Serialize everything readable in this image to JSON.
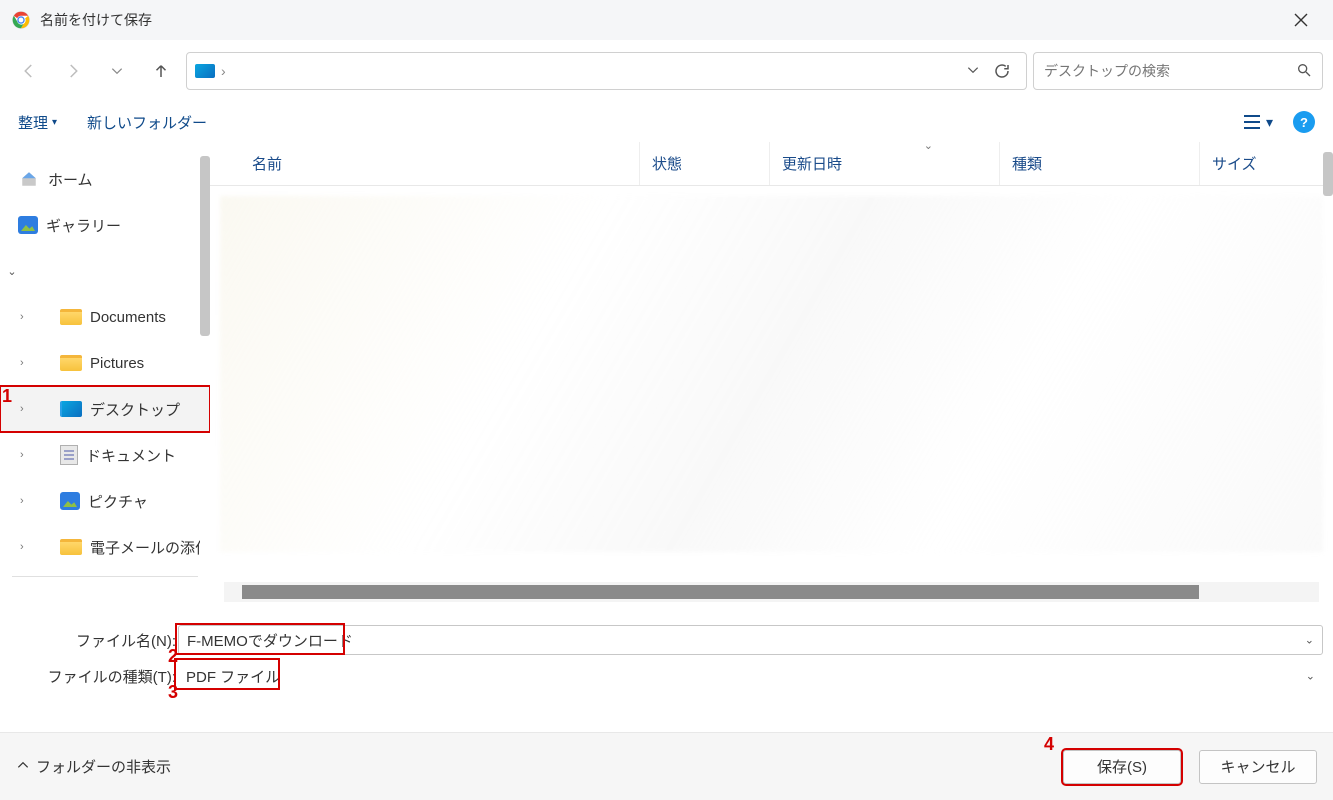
{
  "window": {
    "title": "名前を付けて保存"
  },
  "nav": {
    "path_separator": "›",
    "search_placeholder": "デスクトップの検索"
  },
  "toolbar": {
    "organize": "整理",
    "new_folder": "新しいフォルダー"
  },
  "sidebar": {
    "home": "ホーム",
    "gallery": "ギャラリー",
    "items": [
      {
        "label": "Documents"
      },
      {
        "label": "Pictures"
      },
      {
        "label": "デスクトップ"
      },
      {
        "label": "ドキュメント"
      },
      {
        "label": "ピクチャ"
      },
      {
        "label": "電子メールの添付"
      }
    ]
  },
  "columns": {
    "name": "名前",
    "state": "状態",
    "modified": "更新日時",
    "kind": "種類",
    "size": "サイズ"
  },
  "fields": {
    "filename_label": "ファイル名(N):",
    "filename_value": "F-MEMOでダウンロード",
    "filetype_label": "ファイルの種類(T):",
    "filetype_value": "PDF ファイル"
  },
  "bottom": {
    "hide_folders": "フォルダーの非表示",
    "save": "保存(S)",
    "cancel": "キャンセル"
  },
  "annotations": {
    "a1": "1",
    "a2": "2",
    "a3": "3",
    "a4": "4"
  }
}
